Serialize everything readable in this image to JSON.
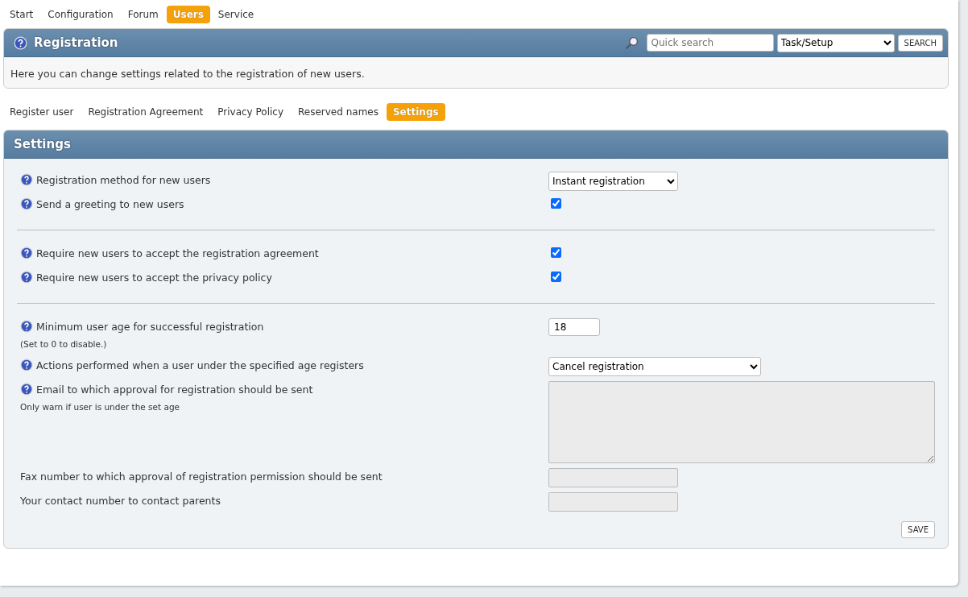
{
  "top_nav": [
    {
      "label": "Start",
      "selected": false
    },
    {
      "label": "Configuration",
      "selected": false
    },
    {
      "label": "Forum",
      "selected": false
    },
    {
      "label": "Users",
      "selected": true
    },
    {
      "label": "Service",
      "selected": false
    }
  ],
  "header": {
    "title": "Registration",
    "search": {
      "placeholder": "Quick search"
    },
    "scope": "Task/Setup",
    "search_button": "SEARCH"
  },
  "intro": "Here you can change settings related to the registration of new users.",
  "sub_tabs": [
    {
      "label": "Register user",
      "selected": false
    },
    {
      "label": "Registration Agreement",
      "selected": false
    },
    {
      "label": "Privacy Policy",
      "selected": false
    },
    {
      "label": "Reserved names",
      "selected": false
    },
    {
      "label": "Settings",
      "selected": true
    }
  ],
  "settings": {
    "title": "Settings",
    "groups": [
      [
        {
          "kind": "select",
          "help": true,
          "label": "Registration method for new users",
          "value": "Instant registration"
        },
        {
          "kind": "checkbox",
          "help": true,
          "label": "Send a greeting to new users",
          "checked": true
        }
      ],
      [
        {
          "kind": "checkbox",
          "help": true,
          "label": "Require new users to accept the registration agreement",
          "checked": true
        },
        {
          "kind": "checkbox",
          "help": true,
          "label": "Require new users to accept the privacy policy",
          "checked": true
        }
      ],
      [
        {
          "kind": "number",
          "help": true,
          "label": "Minimum user age for successful registration",
          "note": "(Set to 0 to disable.)",
          "value": "18"
        },
        {
          "kind": "select-wide",
          "help": true,
          "label": "Actions performed when a user under the specified age registers",
          "value": "Cancel registration"
        },
        {
          "kind": "textarea",
          "help": true,
          "label": "Email to which approval for registration should be sent",
          "note": "Only warn if user is under the set age",
          "disabled": true
        },
        {
          "kind": "text",
          "help": false,
          "label": "Fax number to which approval of registration permission should be sent",
          "disabled": true
        },
        {
          "kind": "text",
          "help": false,
          "label": "Your contact number to contact parents",
          "disabled": true
        }
      ]
    ],
    "save_button": "SAVE"
  }
}
